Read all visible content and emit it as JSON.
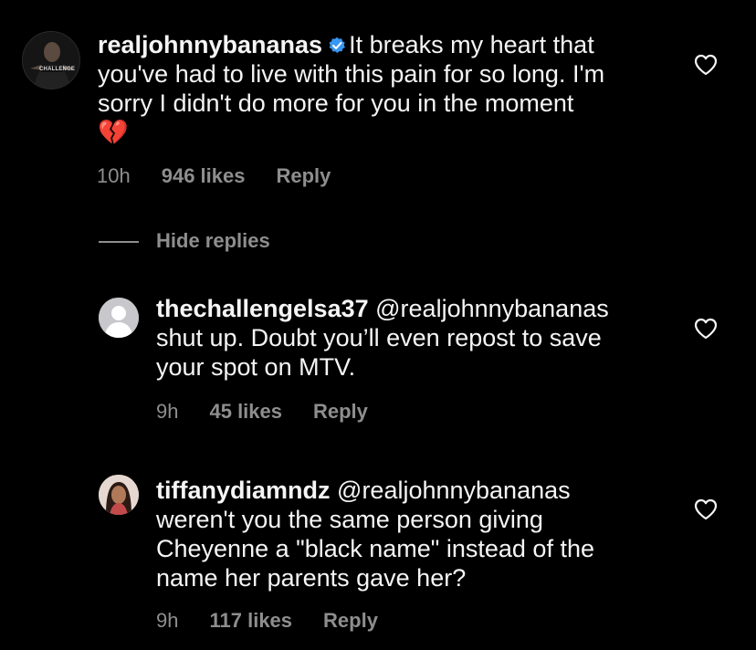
{
  "comment": {
    "username": "realjohnnybananas",
    "text": "It breaks my heart that you've had to live with this pain for so long. I'm sorry I didn't do more for you in the moment",
    "line1": "It breaks my heart that",
    "line2": "you've had to live with this pain for so long. I'm",
    "line3": "sorry I didn't do more for you in the moment",
    "emoji": "💔",
    "time": "10h",
    "likes": "946 likes",
    "reply_label": "Reply",
    "avatar_badge": "CHALLENGE"
  },
  "hide_replies_label": "Hide replies",
  "replies": [
    {
      "username": "thechallengelsa37",
      "mention": "@realjohnnybananas",
      "line1": "shut up. Doubt you’ll even repost to save",
      "line2": "your spot on MTV.",
      "time": "9h",
      "likes": "45 likes",
      "reply_label": "Reply"
    },
    {
      "username": "tiffanydiamndz",
      "mention": "@realjohnnybananas",
      "line1": "weren't you the same person giving",
      "line2": "Cheyenne a \"black name\" instead of the",
      "line3": "name her parents gave her?",
      "time": "9h",
      "likes": "117 likes",
      "reply_label": "Reply"
    }
  ],
  "colors": {
    "background": "#000000",
    "text": "#f5f5f5",
    "muted": "#8e8e8e",
    "verified": "#3897f0"
  }
}
